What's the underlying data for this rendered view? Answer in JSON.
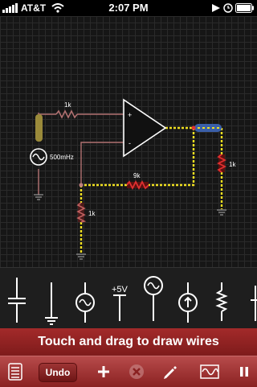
{
  "status_bar": {
    "carrier": "AT&T",
    "time": "2:07 PM",
    "signal_icon": "signal-bars-icon",
    "wifi_icon": "wifi-icon",
    "play_icon": "play-icon",
    "clock_icon": "clock-icon",
    "battery_icon": "battery-icon"
  },
  "circuit": {
    "resistor_input_label": "1k",
    "source_label": "500mHz",
    "opamp_plus": "+",
    "opamp_minus": "-",
    "resistor_feedback_label": "9k",
    "resistor_ground_label": "1k",
    "resistor_output_label": "1k"
  },
  "palette": {
    "items": [
      {
        "icon": "capacitor-icon"
      },
      {
        "icon": "ground-icon"
      },
      {
        "icon": "ac-source-icon"
      },
      {
        "icon": "dc-rail-icon",
        "label": "+5V"
      },
      {
        "icon": "ac-voltage-source-icon"
      },
      {
        "icon": "current-source-icon"
      },
      {
        "icon": "resistor-icon"
      },
      {
        "icon": "partial-component-icon"
      }
    ]
  },
  "hint": "Touch and drag to draw wires",
  "toolbar": {
    "menu_icon": "list-icon",
    "undo_label": "Undo",
    "add_icon": "plus-icon",
    "delete_icon": "delete-icon",
    "pen_icon": "pencil-icon",
    "scope_icon": "oscilloscope-icon",
    "pause_icon": "pause-icon"
  },
  "colors": {
    "wire_active": "#f0e020",
    "wire_inactive": "#b07070",
    "toolbar": "#8a2121",
    "grid_background": "#161616"
  }
}
